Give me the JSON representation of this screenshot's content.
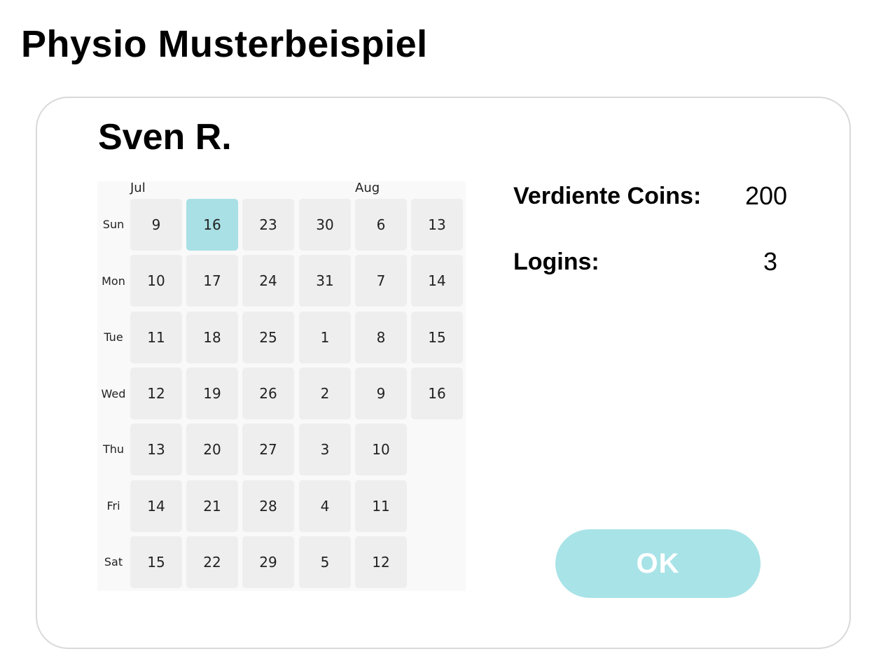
{
  "app": {
    "title": "Physio Musterbeispiel"
  },
  "patient": {
    "name": "Sven R."
  },
  "calendar": {
    "months": [
      "Jul",
      "Aug"
    ],
    "day_labels": [
      "Sun",
      "Mon",
      "Tue",
      "Wed",
      "Thu",
      "Fri",
      "Sat"
    ],
    "weeks": [
      [
        "9",
        "10",
        "11",
        "12",
        "13",
        "14",
        "15"
      ],
      [
        "16",
        "17",
        "18",
        "19",
        "20",
        "21",
        "22"
      ],
      [
        "23",
        "24",
        "25",
        "26",
        "27",
        "28",
        "29"
      ],
      [
        "30",
        "31",
        "1",
        "2",
        "3",
        "4",
        "5"
      ],
      [
        "6",
        "7",
        "8",
        "9",
        "10",
        "11",
        "12"
      ],
      [
        "13",
        "14",
        "15",
        "16",
        "",
        "",
        ""
      ]
    ],
    "selected": {
      "week": 1,
      "day": 0
    },
    "selected_color": "#a8e0e5"
  },
  "stats": {
    "coins_label": "Verdiente Coins:",
    "coins_value": "200",
    "logins_label": "Logins:",
    "logins_value": "3"
  },
  "actions": {
    "ok_label": "OK",
    "ok_color": "#a8e3e7"
  }
}
